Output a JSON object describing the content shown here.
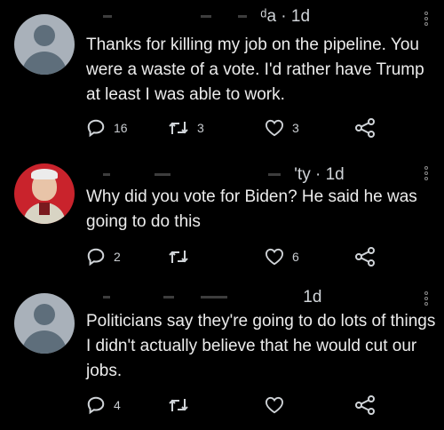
{
  "tweets": [
    {
      "meta_suffix": "ᵈa · 1d",
      "text": "Thanks for killing my job on the pipeline. You were a waste of a vote. I'd rather have Trump at least I was able to work.",
      "replies": "16",
      "retweets": "3",
      "likes": "3"
    },
    {
      "meta_suffix": "'ty · 1d",
      "text": "Why did you vote for Biden? He said he was going to do this",
      "replies": "2",
      "retweets": "",
      "likes": "6"
    },
    {
      "meta_suffix": "1d",
      "text": "Politicians say they're going to do lots of things I didn't actually believe that he would cut our jobs.",
      "replies": "4",
      "retweets": "",
      "likes": ""
    }
  ],
  "icons": {
    "reply": "reply-icon",
    "retweet": "retweet-icon",
    "like": "like-icon",
    "share": "share-icon",
    "more": "more-options-icon"
  },
  "colors": {
    "background": "#000000",
    "text": "#e7e9ea",
    "avatar_default": "#a9b1ba"
  }
}
